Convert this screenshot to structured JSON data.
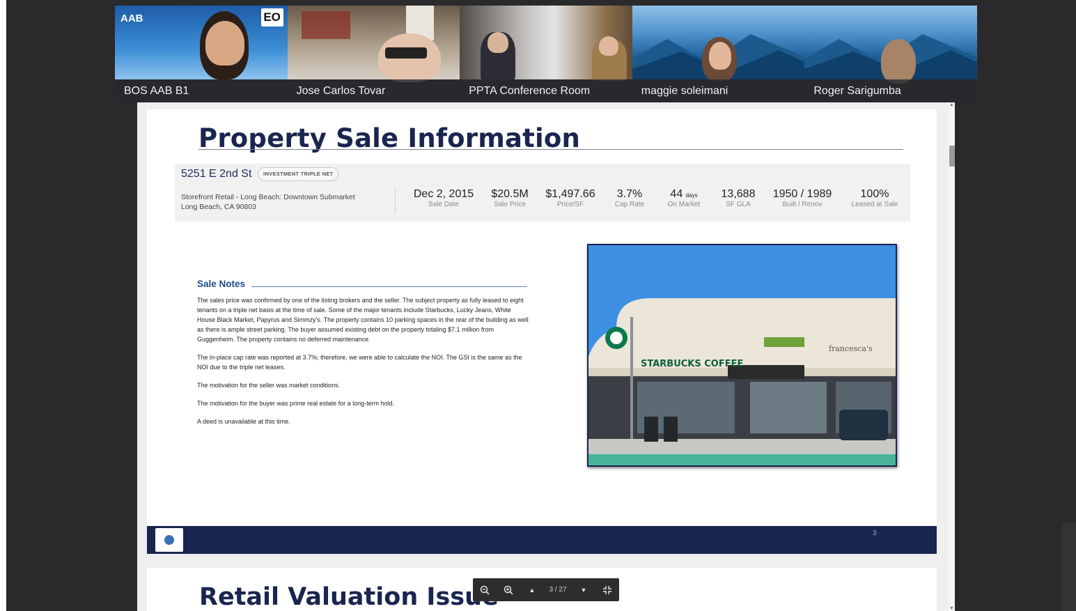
{
  "participants": [
    {
      "name": "BOS AAB B1",
      "logo_text": "AAB",
      "badge_text": "EO"
    },
    {
      "name": "Jose Carlos Tovar"
    },
    {
      "name": "PPTA Conference Room"
    },
    {
      "name": "maggie soleimani"
    },
    {
      "name": "Roger Sarigumba"
    }
  ],
  "document": {
    "title": "Property Sale Information",
    "address": "5251 E 2nd St",
    "badge": "INVESTMENT TRIPLE NET",
    "subtype_line1": "Storefront Retail - Long Beach: Downtown Submarket",
    "subtype_line2": "Long Beach, CA 90803",
    "stats": [
      {
        "value": "Dec 2, 2015",
        "label": "Sale Date"
      },
      {
        "value": "$20.5M",
        "label": "Sale Price"
      },
      {
        "value": "$1,497.66",
        "label": "Price/SF"
      },
      {
        "value": "3.7%",
        "label": "Cap Rate"
      },
      {
        "value": "44",
        "unit": "days",
        "label": "On Market"
      },
      {
        "value": "13,688",
        "label": "SF GLA"
      },
      {
        "value": "1950 / 1989",
        "label": "Built / Renov"
      },
      {
        "value": "100%",
        "label": "Leased at Sale"
      }
    ],
    "notes_heading": "Sale Notes",
    "notes": [
      "The sales price was confirmed by one of the listing brokers and the seller. The subject property as fully leased to eight tenants on a triple net basis at the time of sale. Some of the major tenants include Starbucks, Lucky Jeans, White House Black Market, Papyrus and Simmzy's. The property contains 10 parking spaces in the rear of the building as well as there is ample street parking. The buyer assumed existing debt on the property totaling $7.1 million from Guggenheim. The property contains no deferred maintenance.",
      "The in-place cap rate was reported at 3.7%; therefore, we were able to calculate the NOI. The GSI is the same as the NOI due to the triple net leases.",
      "The motivation for the seller was market conditions.",
      "The motivation for the buyer was prime real estate for a long-term hold.",
      "A deed is unavailable at this time."
    ],
    "photo_sign": "STARBUCKS COFFEE",
    "photo_sign2": "francesca's",
    "page_number": "3",
    "next_title": "Retail Valuation Issue"
  },
  "toolbar": {
    "page_indicator": "3 / 27"
  }
}
